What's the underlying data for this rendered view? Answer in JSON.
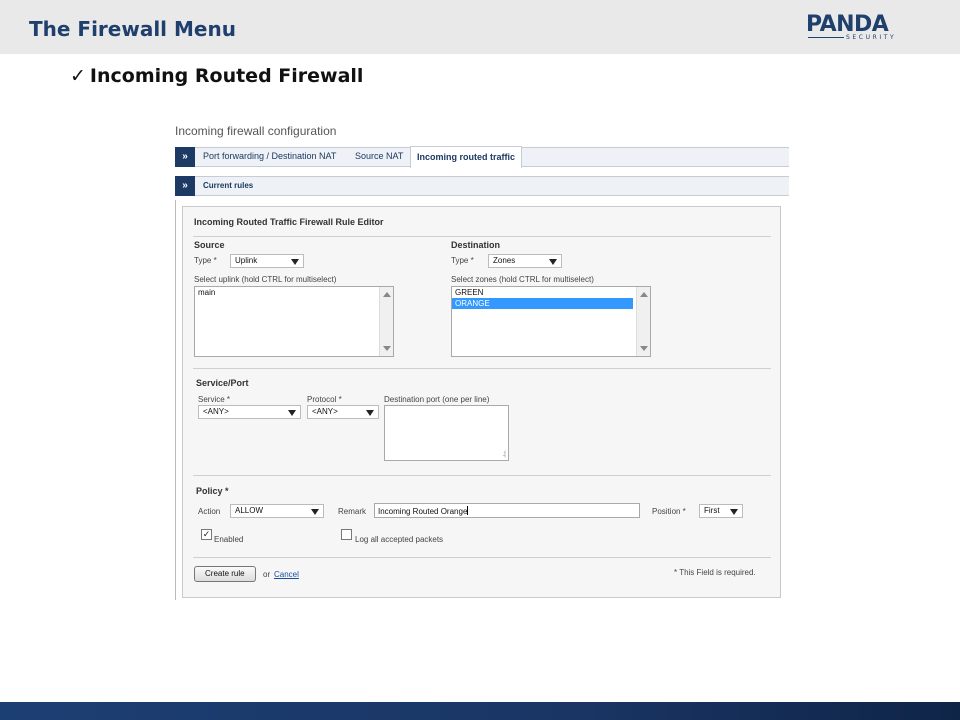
{
  "slide": {
    "title": "The Firewall Menu",
    "subtitle_check": "✓",
    "subtitle": "Incoming Routed Firewall",
    "logo": {
      "word": "PANDA",
      "sub": "SECURITY",
      "color": "#1f3f6d"
    }
  },
  "page": {
    "heading": "Incoming firewall configuration",
    "toggle_glyph": "»",
    "tabs": [
      {
        "label": "Port forwarding / Destination NAT",
        "active": false
      },
      {
        "label": "Source NAT",
        "active": false
      },
      {
        "label": "Incoming routed traffic",
        "active": true
      }
    ],
    "current_rules_label": "Current rules"
  },
  "editor": {
    "title": "Incoming Routed Traffic Firewall Rule Editor",
    "source": {
      "section_title": "Source",
      "type_label": "Type *",
      "type_value": "Uplink",
      "list_label": "Select uplink (hold CTRL for multiselect)",
      "options": [
        {
          "label": "main",
          "selected": false
        }
      ]
    },
    "destination": {
      "section_title": "Destination",
      "type_label": "Type *",
      "type_value": "Zones",
      "list_label": "Select zones (hold CTRL for multiselect)",
      "options": [
        {
          "label": "GREEN",
          "selected": false
        },
        {
          "label": "ORANGE",
          "selected": true
        }
      ]
    },
    "service": {
      "section_title": "Service/Port",
      "service_label": "Service *",
      "service_value": "<ANY>",
      "protocol_label": "Protocol *",
      "protocol_value": "<ANY>",
      "port_label": "Destination port (one per line)",
      "port_value": ""
    },
    "policy": {
      "section_title": "Policy *",
      "action_label": "Action",
      "action_value": "ALLOW",
      "remark_label": "Remark",
      "remark_value": "Incoming Routed Orange",
      "position_label": "Position *",
      "position_value": "First",
      "enabled_label": "Enabled",
      "enabled_checked": true,
      "log_label": "Log all accepted packets",
      "log_checked": false
    },
    "actions": {
      "create_label": "Create rule",
      "or_label": "or",
      "cancel_label": "Cancel",
      "required_note": "* This Field is required."
    }
  },
  "colors": {
    "accent": "#1c3a63",
    "selected": "#3399ff",
    "footer": "#1c3f73"
  }
}
